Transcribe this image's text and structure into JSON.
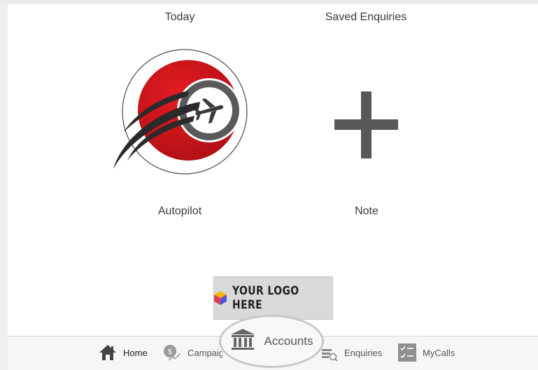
{
  "tiles": {
    "today_label": "Today",
    "saved_enquiries_label": "Saved Enquiries",
    "autopilot_label": "Autopilot",
    "note_label": "Note",
    "autopilot_icon": "airplane-logo-icon",
    "note_icon": "plus-icon"
  },
  "logo": {
    "text": "YOUR LOGO HERE",
    "icon": "cube-logo-icon"
  },
  "nav": {
    "items": [
      {
        "label": "Home",
        "icon": "house-icon"
      },
      {
        "label": "Campaigns",
        "icon": "money-bag-growth-icon"
      },
      {
        "label": "Accounts",
        "icon": "bank-icon"
      },
      {
        "label": "Enquiries",
        "icon": "enquiries-search-icon"
      },
      {
        "label": "MyCalls",
        "icon": "checklist-icon"
      }
    ]
  },
  "colors": {
    "accent_red": "#d0181d",
    "icon_gray": "#555555",
    "background": "#ffffff"
  }
}
